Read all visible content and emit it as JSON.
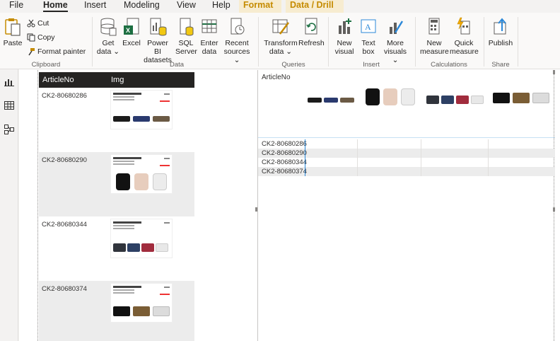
{
  "tabs": {
    "file": "File",
    "home": "Home",
    "insert": "Insert",
    "modeling": "Modeling",
    "view": "View",
    "help": "Help",
    "format": "Format",
    "data_drill": "Data / Drill"
  },
  "ribbon": {
    "clipboard": {
      "label": "Clipboard",
      "paste": "Paste",
      "cut": "Cut",
      "copy": "Copy",
      "format_painter": "Format painter"
    },
    "data": {
      "label": "Data",
      "get_data_1": "Get",
      "get_data_2": "data ⌄",
      "excel": "Excel",
      "pbi_1": "Power BI",
      "pbi_2": "datasets",
      "sql_1": "SQL",
      "sql_2": "Server",
      "enter_1": "Enter",
      "enter_2": "data",
      "recent_1": "Recent",
      "recent_2": "sources ⌄"
    },
    "queries": {
      "label": "Queries",
      "transform_1": "Transform",
      "transform_2": "data ⌄",
      "refresh": "Refresh"
    },
    "insert": {
      "label": "Insert",
      "new_visual_1": "New",
      "new_visual_2": "visual",
      "text_box_1": "Text",
      "text_box_2": "box",
      "more_visuals_1": "More",
      "more_visuals_2": "visuals ⌄"
    },
    "calculations": {
      "label": "Calculations",
      "new_measure_1": "New",
      "new_measure_2": "measure",
      "quick_measure_1": "Quick",
      "quick_measure_2": "measure"
    },
    "share": {
      "label": "Share",
      "publish": "Publish"
    }
  },
  "table_visual": {
    "headers": {
      "article": "ArticleNo",
      "img": "Img"
    },
    "rows": [
      {
        "article": "CK2-80680286"
      },
      {
        "article": "CK2-80680290"
      },
      {
        "article": "CK2-80680344"
      },
      {
        "article": "CK2-80680374"
      }
    ]
  },
  "matrix_visual": {
    "header_label": "ArticleNo",
    "rows": [
      "CK2-80680286",
      "CK2-80680290",
      "CK2-80680344",
      "CK2-80680374"
    ]
  },
  "colors": {
    "accent_gold": "#c58b00",
    "table_header": "#252423",
    "excel_green": "#1d6f42",
    "selection_blue": "#2b88d8"
  }
}
